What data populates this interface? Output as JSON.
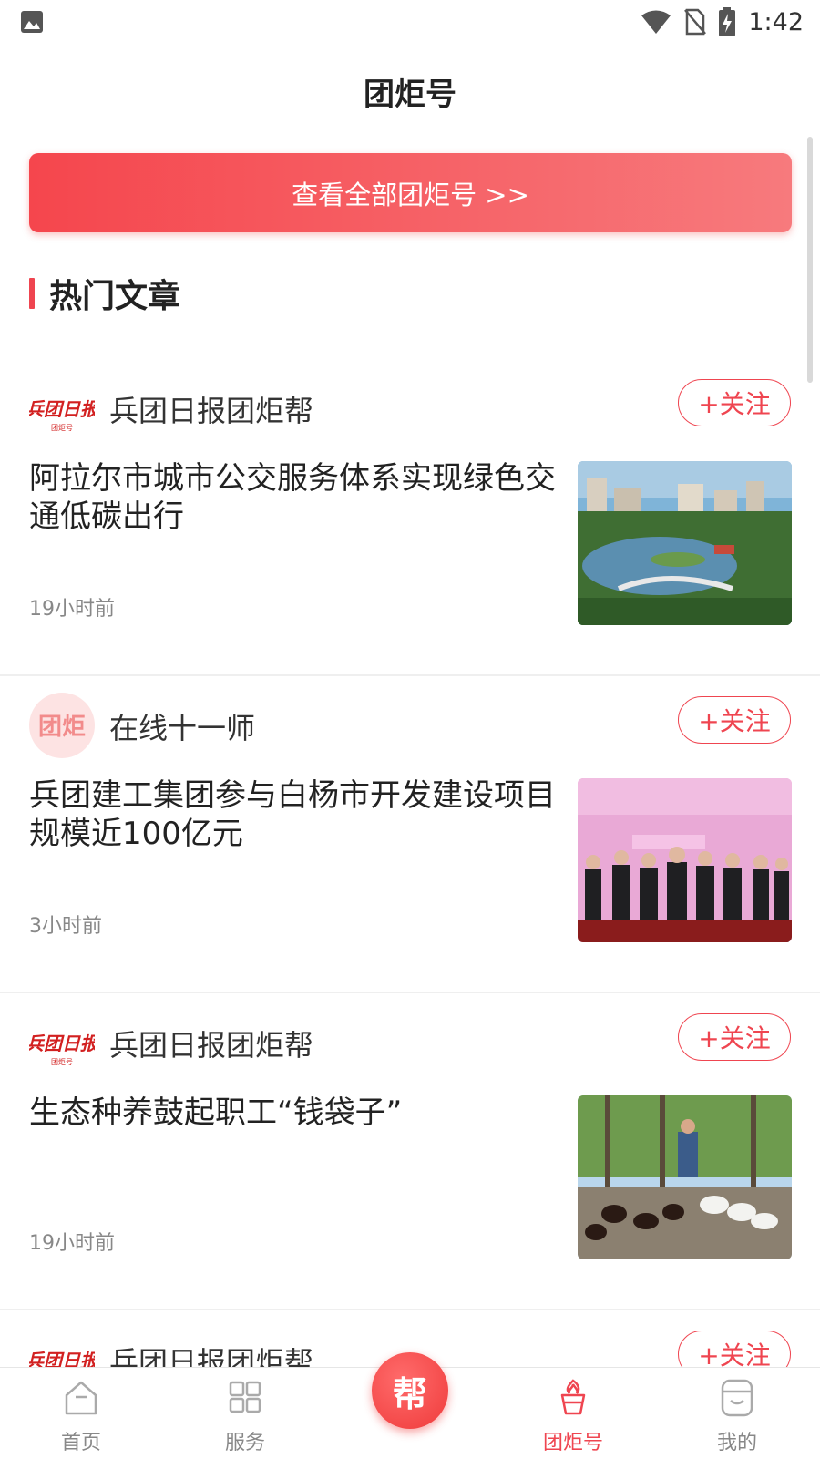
{
  "status_bar": {
    "time": "1:42"
  },
  "header": {
    "title": "团炬号"
  },
  "banner": {
    "label": "查看全部团炬号 >>"
  },
  "section": {
    "title": "热门文章"
  },
  "articles": [
    {
      "author": "兵团日报团炬帮",
      "follow_label": "+关注",
      "headline": "阿拉尔市城市公交服务体系实现绿色交通低碳出行",
      "time": "19小时前",
      "logo_text": "兵团日报",
      "logo_sub": "团炬号"
    },
    {
      "author": "在线十一师",
      "follow_label": "+关注",
      "headline": "兵团建工集团参与白杨市开发建设项目规模近100亿元",
      "time": "3小时前",
      "logo_text": "团炬"
    },
    {
      "author": "兵团日报团炬帮",
      "follow_label": "+关注",
      "headline": "生态种养鼓起职工“钱袋子”",
      "time": "19小时前",
      "logo_text": "兵团日报",
      "logo_sub": "团炬号"
    },
    {
      "author": "兵团日报团炬帮",
      "follow_label": "+关注",
      "logo_text": "兵团日报"
    }
  ],
  "tabbar": {
    "home": "首页",
    "service": "服务",
    "help": "帮",
    "tuanju": "团炬号",
    "mine": "我的"
  },
  "colors": {
    "accent": "#ef4550"
  }
}
